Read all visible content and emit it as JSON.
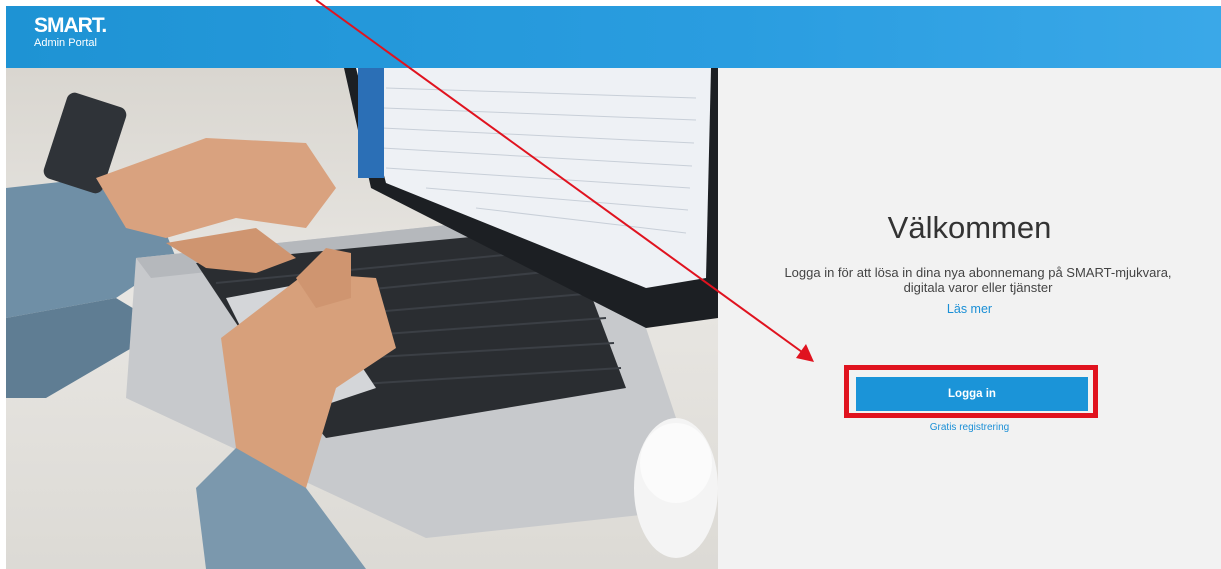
{
  "header": {
    "logo_text": "SMART.",
    "logo_subtitle": "Admin Portal",
    "color": "#1e93d4"
  },
  "hero": {
    "icon": "laptop-typing-photo"
  },
  "login_panel": {
    "title": "Välkommen",
    "description": "Logga in för att lösa in dina nya abonnemang på SMART-mjukvara, digitala varor eller tjänster",
    "read_more_link": "Läs mer",
    "login_button_label": "Logga in",
    "register_link": "Gratis registrering",
    "accent_color": "#1b94d8"
  },
  "annotations": {
    "highlight_color": "#e0131f",
    "arrow_color": "#e0131f"
  }
}
